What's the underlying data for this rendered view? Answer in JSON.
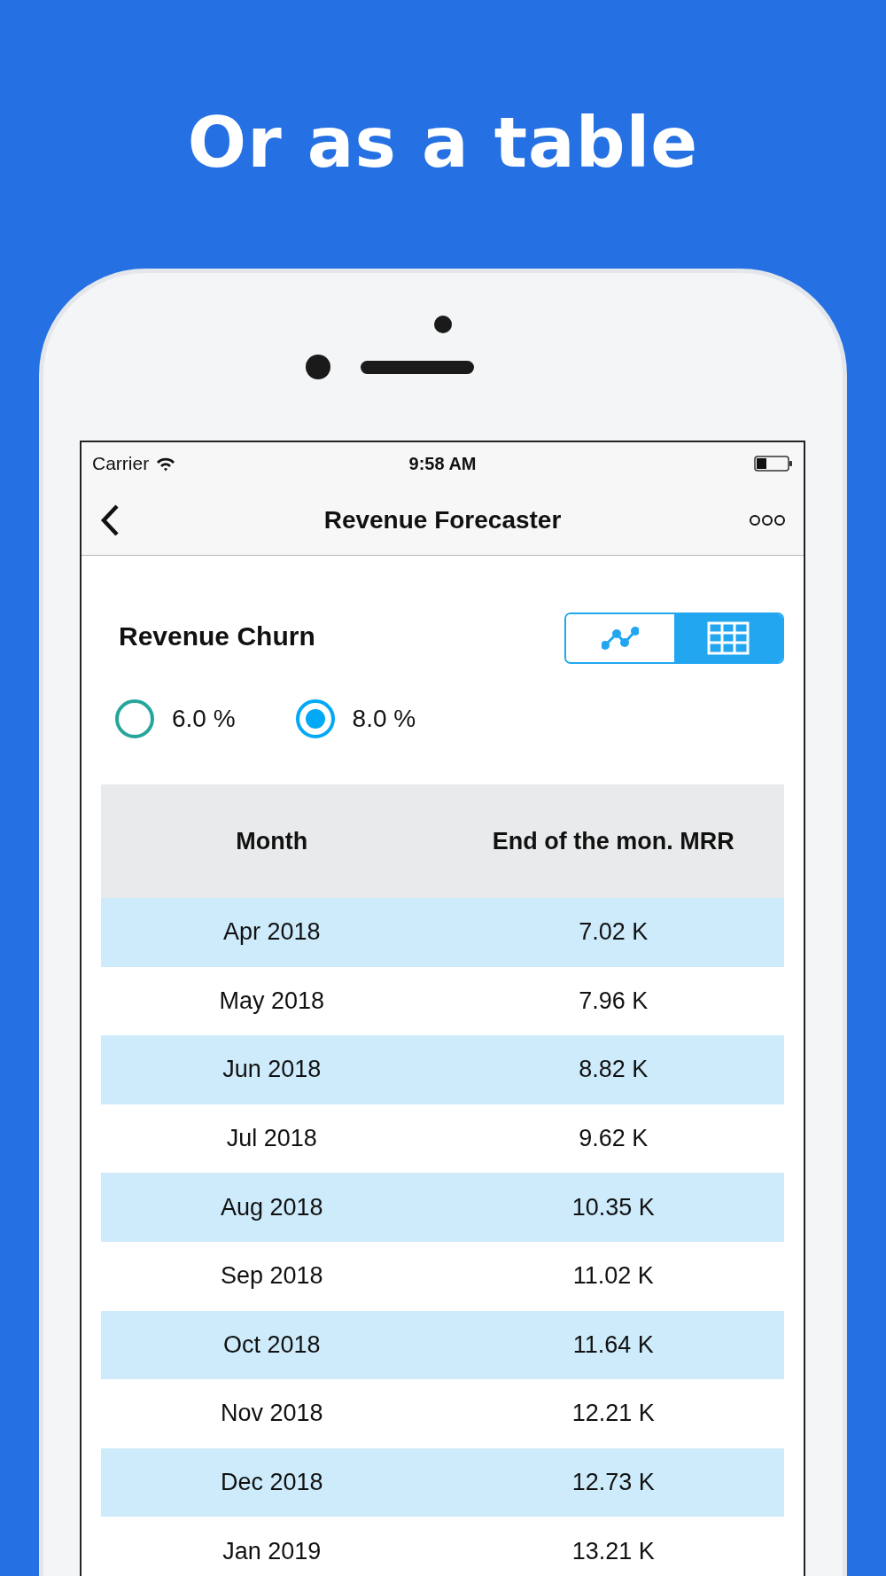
{
  "headline": "Or as a table",
  "status_bar": {
    "carrier": "Carrier",
    "time": "9:58 AM"
  },
  "nav_bar": {
    "title": "Revenue Forecaster"
  },
  "section": {
    "title": "Revenue Churn",
    "view_toggle": [
      {
        "kind": "chart",
        "selected": false
      },
      {
        "kind": "table",
        "selected": true
      }
    ],
    "options": [
      {
        "label": "6.0 %",
        "selected": false,
        "color": "#26a69a"
      },
      {
        "label": "8.0 %",
        "selected": true,
        "color": "#03a9f4"
      }
    ]
  },
  "table": {
    "columns": [
      "Month",
      "End of the mon. MRR"
    ],
    "rows": [
      [
        "Apr 2018",
        "7.02 K"
      ],
      [
        "May 2018",
        "7.96 K"
      ],
      [
        "Jun 2018",
        "8.82 K"
      ],
      [
        "Jul 2018",
        "9.62 K"
      ],
      [
        "Aug 2018",
        "10.35 K"
      ],
      [
        "Sep 2018",
        "11.02 K"
      ],
      [
        "Oct 2018",
        "11.64 K"
      ],
      [
        "Nov 2018",
        "12.21 K"
      ],
      [
        "Dec 2018",
        "12.73 K"
      ],
      [
        "Jan 2019",
        "13.21 K"
      ]
    ]
  }
}
